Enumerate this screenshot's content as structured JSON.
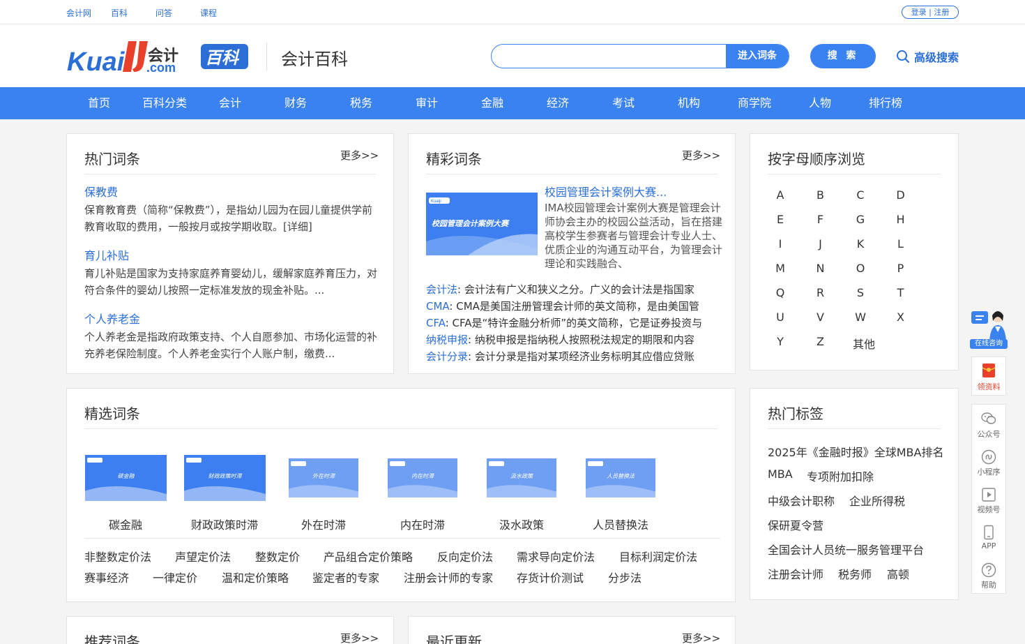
{
  "topbar": {
    "links": [
      "会计网",
      "百科",
      "问答",
      "课程"
    ],
    "login": "登录 | 注册"
  },
  "header": {
    "logo_text": "Kuaiji.com 会计百科",
    "site_title": "会计百科",
    "search_placeholder": "",
    "enter_button": "进入词条",
    "search_button": "搜 索",
    "advanced_search": "高级搜索"
  },
  "nav": [
    "首页",
    "百科分类",
    "会计",
    "财务",
    "税务",
    "审计",
    "金融",
    "经济",
    "考试",
    "机构",
    "商学院",
    "人物",
    "排行榜"
  ],
  "hot": {
    "title": "热门词条",
    "more": "更多>>",
    "items": [
      {
        "title": "保教费",
        "desc": "保育教育费（简称“保教费”），是指幼儿园为在园儿童提供学前教育收取的费用，一般按月或按学期收取。[详细]"
      },
      {
        "title": "育儿补贴",
        "desc": "育儿补贴是国家为支持家庭养育婴幼儿，缓解家庭养育压力，对符合条件的婴幼儿按照一定标准发放的现金补贴。..."
      },
      {
        "title": "个人养老金",
        "desc": "个人养老金是指政府政策支持、个人自愿参加、市场化运营的补充养老保险制度。个人养老金实行个人账户制，缴费..."
      }
    ]
  },
  "wonderful": {
    "title": "精彩词条",
    "more": "更多>>",
    "feature": {
      "title": "校园管理会计案例大赛...",
      "image_text": "校园管理会计案例大赛",
      "desc": "IMA校园管理会计案例大赛是管理会计师协会主办的校园公益活动，旨在搭建高校学生参赛者与管理会计专业人士、优质企业的沟通互动平台，为管理会计理论和实践融合、"
    },
    "lines": [
      {
        "k": "会计法",
        "v": ": 会计法有广义和狭义之分。广义的会计法是指国家"
      },
      {
        "k": "CMA",
        "v": ": CMA是美国注册管理会计师的英文简称，是由美国管"
      },
      {
        "k": "CFA",
        "v": ": CFA是“特许金融分析师”的英文简称，它是证券投资与"
      },
      {
        "k": "纳税申报",
        "v": ": 纳税申报是指纳税人按照税法规定的期限和内容"
      },
      {
        "k": "会计分录",
        "v": ": 会计分录是指对某项经济业务标明其应借应贷账"
      }
    ]
  },
  "alpha": {
    "title": "按字母顺序浏览",
    "letters": [
      "A",
      "B",
      "C",
      "D",
      "E",
      "F",
      "G",
      "H",
      "I",
      "J",
      "K",
      "L",
      "M",
      "N",
      "O",
      "P",
      "Q",
      "R",
      "S",
      "T",
      "U",
      "V",
      "W",
      "X",
      "Y",
      "Z",
      "其他"
    ]
  },
  "selected": {
    "title": "精选词条",
    "thumbs": [
      {
        "label": "碳金融",
        "img": "碳金融"
      },
      {
        "label": "财政政策时滞",
        "img": "财政政策时滞"
      },
      {
        "label": "外在时滞",
        "img": "外在时滞"
      },
      {
        "label": "内在时滞",
        "img": "内在时滞"
      },
      {
        "label": "汲水政策",
        "img": "汲水政策"
      },
      {
        "label": "人员替换法",
        "img": "人员替换法"
      }
    ],
    "row1": [
      "非整数定价法",
      "声望定价法",
      "整数定价",
      "产品组合定价策略",
      "反向定价法",
      "需求导向定价法",
      "目标利润定价法"
    ],
    "row2": [
      "赛事经济",
      "一律定价",
      "温和定价策略",
      "鉴定者的专家",
      "注册会计师的专家",
      "存货计价测试",
      "分步法"
    ]
  },
  "hot_tags": {
    "title": "热门标签",
    "rows": [
      [
        "2025年《金融时报》全球MBA排名"
      ],
      [
        "MBA",
        "专项附加扣除"
      ],
      [
        "中级会计职称",
        "企业所得税"
      ],
      [
        "保研夏令营"
      ],
      [
        "全国会计人员统一服务管理平台"
      ],
      [
        "注册会计师",
        "税务师",
        "高顿"
      ]
    ]
  },
  "recommend": {
    "title": "推荐词条",
    "more": "更多>>"
  },
  "recent": {
    "title": "最近更新",
    "more": "更多>>"
  },
  "float": {
    "consult": "在线咨询",
    "materials": "领资料",
    "items": [
      "公众号",
      "小程序",
      "视频号",
      "APP",
      "帮助"
    ]
  },
  "colors": {
    "brand": "#3a82ef",
    "link": "#2b6fd6",
    "accent_red": "#e8402a"
  }
}
